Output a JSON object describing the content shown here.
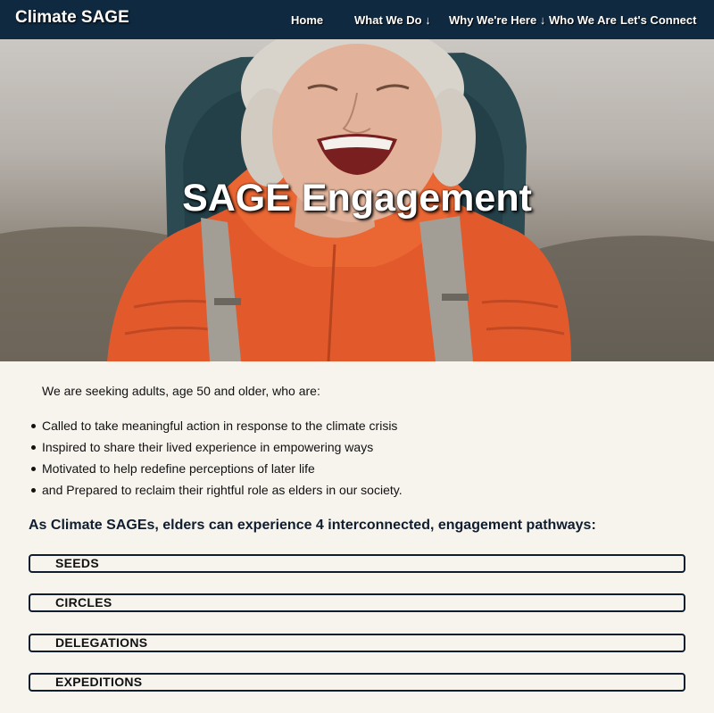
{
  "navbar": {
    "brand": "Climate SAGE",
    "items": [
      {
        "label": "Home"
      },
      {
        "label": "What We Do ↓"
      },
      {
        "label": "Why We're Here ↓"
      },
      {
        "label": "Who We Are"
      },
      {
        "label": "Let's Connect"
      }
    ]
  },
  "hero": {
    "title": "SAGE Engagement",
    "image_icon": "smiling-elder-hiker-photo"
  },
  "main": {
    "intro": "We are seeking adults, age 50 and older, who are:",
    "bullets": [
      "Called to take meaningful action in response to the climate crisis",
      "Inspired to share their lived experience in empowering ways",
      "Motivated to help redefine perceptions of later life",
      "and Prepared to reclaim their rightful role as elders in our society."
    ],
    "pathways_heading": "As Climate SAGEs, elders can experience 4 interconnected, engagement pathways:",
    "pathways": [
      {
        "label": "SEEDS"
      },
      {
        "label": "CIRCLES"
      },
      {
        "label": "DELEGATIONS"
      },
      {
        "label": "EXPEDITIONS"
      }
    ]
  },
  "colors": {
    "navbar_bg": "#0f2940",
    "page_bg": "#f7f4ee",
    "jacket_orange": "#e4572e",
    "text_dark": "#0f1d2e"
  }
}
